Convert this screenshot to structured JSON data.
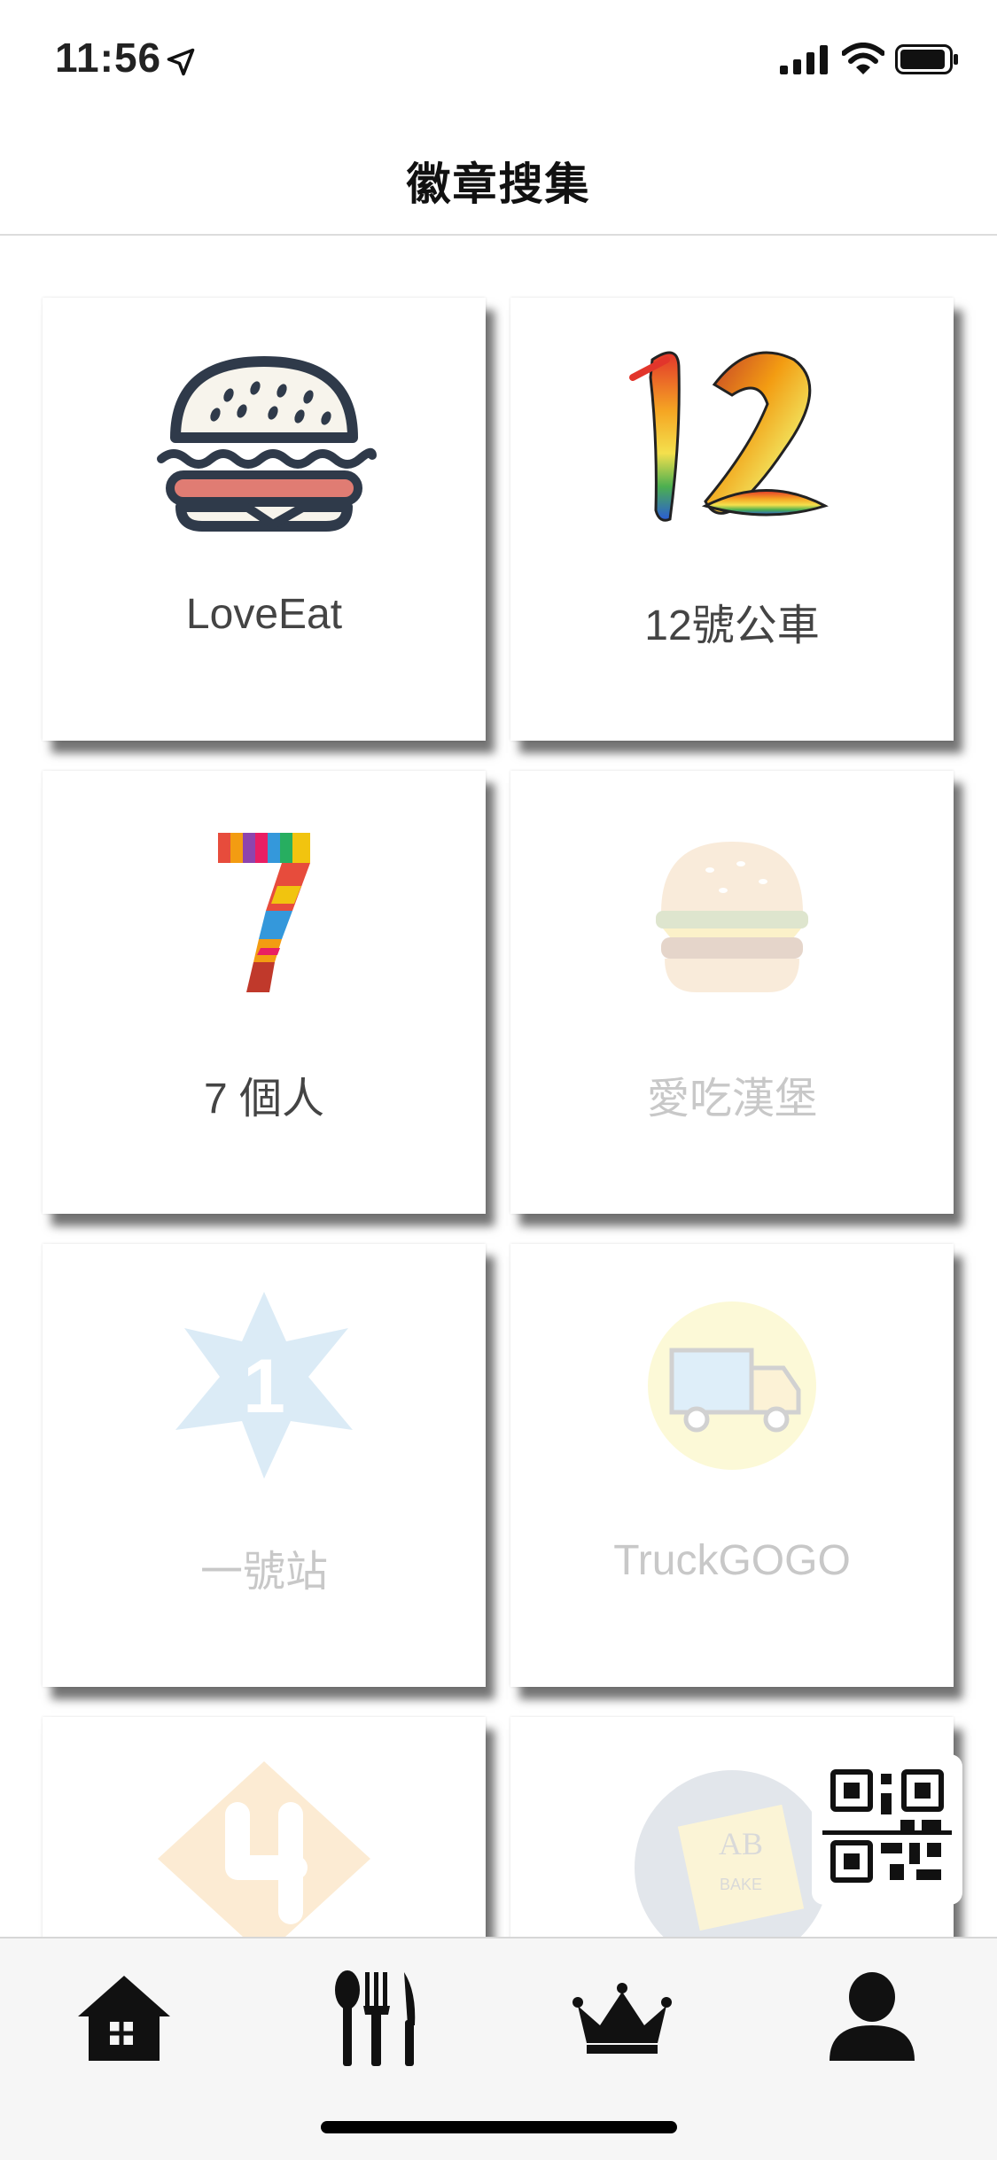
{
  "status_bar": {
    "time": "11:56"
  },
  "header": {
    "title": "徽章搜集"
  },
  "badges": [
    {
      "label": "LoveEat",
      "icon": "burger-icon",
      "locked": false
    },
    {
      "label": "12號公車",
      "icon": "feather-12-icon",
      "locked": false
    },
    {
      "label": "7 個人",
      "icon": "rainbow-7-icon",
      "locked": false
    },
    {
      "label": "愛吃漢堡",
      "icon": "cheeseburger-icon",
      "locked": true
    },
    {
      "label": "一號站",
      "icon": "star-1-icon",
      "locked": true
    },
    {
      "label": "TruckGOGO",
      "icon": "food-truck-icon",
      "locked": true
    },
    {
      "label": "",
      "icon": "diamond-4-icon",
      "locked": true
    },
    {
      "label": "",
      "icon": "bake-logo-icon",
      "locked": true
    }
  ],
  "tabs": [
    {
      "name": "home",
      "icon": "house-icon"
    },
    {
      "name": "dining",
      "icon": "cutlery-icon"
    },
    {
      "name": "ranking",
      "icon": "crown-icon"
    },
    {
      "name": "profile",
      "icon": "person-icon"
    }
  ],
  "colors": {
    "accent_dark": "#222222",
    "burger_patty": "#e07c73",
    "burger_bun": "#f7f4ec"
  }
}
